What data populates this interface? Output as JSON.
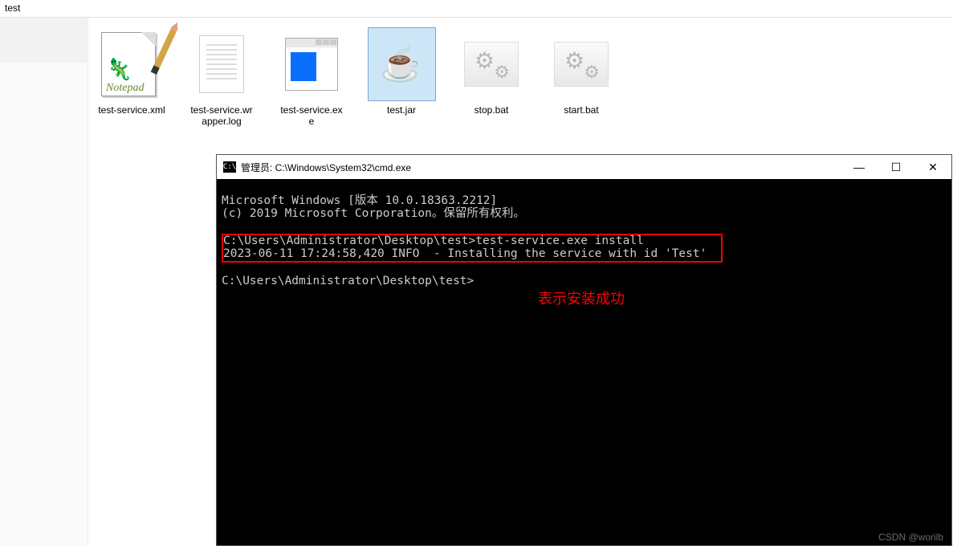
{
  "header": {
    "path": "test"
  },
  "files": [
    {
      "label": "test-service.xml"
    },
    {
      "label": "test-service.wrapper.log"
    },
    {
      "label": "test-service.exe"
    },
    {
      "label": "test.jar"
    },
    {
      "label": "stop.bat"
    },
    {
      "label": "start.bat"
    }
  ],
  "cmd": {
    "title": "管理员: C:\\Windows\\System32\\cmd.exe",
    "icon_text": "C:\\",
    "lines": {
      "l1": "Microsoft Windows [版本 10.0.18363.2212]",
      "l2": "(c) 2019 Microsoft Corporation。保留所有权利。",
      "l3": "",
      "prompt1": "C:\\Users\\Administrator\\Desktop\\test>",
      "cmd1": "test-service.exe install",
      "output1": "2023-06-11 17:24:58,420 INFO  - Installing the service with id 'Test'",
      "l6": "",
      "prompt2": "C:\\Users\\Administrator\\Desktop\\test>"
    },
    "annotation": "表示安装成功",
    "controls": {
      "min": "—",
      "max": "☐",
      "close": "✕"
    }
  },
  "watermark": "CSDN @worilb"
}
